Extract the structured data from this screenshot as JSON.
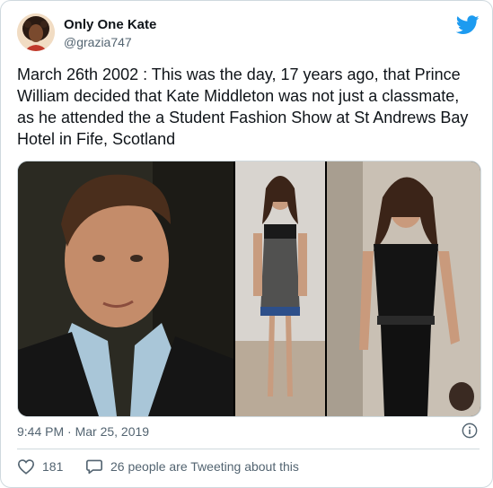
{
  "tweet": {
    "author_name": "Only One Kate",
    "author_handle": "@grazia747",
    "text": "March 26th 2002 : This was the day, 17 years ago, that Prince William decided that Kate Middleton was not just a classmate, as he attended the a Student Fashion Show at St Andrews Bay Hotel in Fife, Scotland",
    "timestamp": "9:44 PM · Mar 25, 2019",
    "like_count": "181",
    "conversation_text": "26 people are Tweeting about this"
  },
  "icons": {
    "logo": "twitter-bird-icon",
    "info": "info-icon",
    "like": "heart-icon",
    "reply": "speech-bubble-icon"
  },
  "colors": {
    "twitter_blue": "#1d9bf0",
    "text_primary": "#0f1419",
    "text_secondary": "#536471",
    "border": "#cfd9de"
  }
}
